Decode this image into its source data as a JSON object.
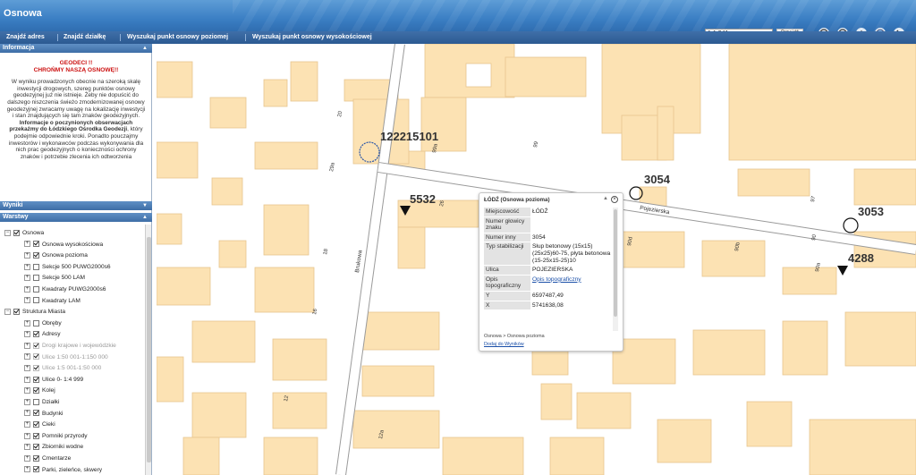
{
  "app": {
    "title": "Osnowa"
  },
  "toolbar": {
    "buttons": [
      "Znajdź adres",
      "Znajdź działkę",
      "Wyszukaj punkt osnowy poziomej",
      "Wyszukaj punkt osnowy wysokościowej"
    ],
    "scale_value": "1:1 241",
    "goto_label": "Przejdź"
  },
  "tools": [
    "zoom-in-icon",
    "zoom-out-icon",
    "pan-hand-icon",
    "zoom-extent-icon",
    "back-arrow-icon"
  ],
  "panels": {
    "info": {
      "title": "Informacja",
      "warning_line1": "GEODECI !!",
      "warning_line2": "CHROŃMY NASZĄ OSNOWĘ!!",
      "body_part1": "W wyniku prowadzonych obecnie na szeroką skalę inwestycji drogowych, szereg punktów osnowy geodezyjnej już nie istnieje. Żeby nie dopuścić do dalszego niszczenia świeżo zmodernizowanej osnowy geodezyjnej zwracamy uwagę na lokalizację inwestycji i stan znajdujących się tam znaków geodezyjnych. ",
      "body_bold1": "Informacje o poczynionych obserwacjach przekażmy do Łódzkiego Ośrodka Geodezji",
      "body_part2": ", który podejmie odpowiednie kroki. Ponadto pouczajmy inwestorów i wykonawców podczas wykonywania dla nich prac geodezyjnych o konieczności ochrony znaków i potrzebie zlecenia ich odtworzenia"
    },
    "results": {
      "title": "Wyniki"
    },
    "layers": {
      "title": "Warstwy",
      "items": [
        {
          "label": "Osnowa",
          "level": 0,
          "checked": true,
          "disabled": false
        },
        {
          "label": "Osnowa wysokościowa",
          "level": 1,
          "checked": true,
          "disabled": false
        },
        {
          "label": "Osnowa pozioma",
          "level": 1,
          "checked": true,
          "disabled": false
        },
        {
          "label": "Sekcje 500 PUWG2000s6",
          "level": 1,
          "checked": false,
          "disabled": false
        },
        {
          "label": "Sekcje 500 LAM",
          "level": 1,
          "checked": false,
          "disabled": false
        },
        {
          "label": "Kwadraty PUWG2000s6",
          "level": 1,
          "checked": false,
          "disabled": false
        },
        {
          "label": "Kwadraty LAM",
          "level": 1,
          "checked": false,
          "disabled": false
        },
        {
          "label": "Struktura Miasta",
          "level": 0,
          "checked": true,
          "disabled": false
        },
        {
          "label": "Obręby",
          "level": 1,
          "checked": false,
          "disabled": false
        },
        {
          "label": "Adresy",
          "level": 1,
          "checked": true,
          "disabled": false
        },
        {
          "label": "Drogi krajowe i wojewódzkie",
          "level": 1,
          "checked": true,
          "disabled": true
        },
        {
          "label": "Ulice 1:50 001-1:150 000",
          "level": 1,
          "checked": true,
          "disabled": true
        },
        {
          "label": "Ulice 1:5 001-1:50 000",
          "level": 1,
          "checked": true,
          "disabled": true
        },
        {
          "label": "Ulice 0- 1:4 999",
          "level": 1,
          "checked": true,
          "disabled": false
        },
        {
          "label": "Kolej",
          "level": 1,
          "checked": true,
          "disabled": false
        },
        {
          "label": "Działki",
          "level": 1,
          "checked": false,
          "disabled": false
        },
        {
          "label": "Budynki",
          "level": 1,
          "checked": true,
          "disabled": false
        },
        {
          "label": "Cieki",
          "level": 1,
          "checked": true,
          "disabled": false
        },
        {
          "label": "Pomniki przyrody",
          "level": 1,
          "checked": true,
          "disabled": false
        },
        {
          "label": "Zbiorniki wodne",
          "level": 1,
          "checked": true,
          "disabled": false
        },
        {
          "label": "Cmentarze",
          "level": 1,
          "checked": true,
          "disabled": false
        },
        {
          "label": "Parki, zieleńce, skwery",
          "level": 1,
          "checked": true,
          "disabled": false
        }
      ]
    }
  },
  "map": {
    "points": [
      "122215101",
      "5532",
      "3054",
      "3053",
      "4288"
    ],
    "streets": [
      "Brukowa",
      "Pojezierska"
    ],
    "numbers": [
      "20",
      "99",
      "99a",
      "29a",
      "26",
      "18",
      "16",
      "12",
      "12a",
      "97",
      "90",
      "90d",
      "90b",
      "90a"
    ]
  },
  "popup": {
    "title": "ŁÓDŹ (Osnowa pozioma)",
    "rows": [
      {
        "key": "Miejscowość",
        "value": "ŁÓDŹ"
      },
      {
        "key": "Numer głowicy znaku",
        "value": ""
      },
      {
        "key": "Numer inny",
        "value": "3054"
      },
      {
        "key": "Typ stabilizacji",
        "value": "Słup betonowy (15x15) (25x25)60-75, płyta betonowa (15-25x15-25)10"
      },
      {
        "key": "Ulica",
        "value": "POJEZIERSKA"
      },
      {
        "key": "Opis topograficzny",
        "value": "Opis topograficzny"
      },
      {
        "key": "Y",
        "value": "6597487,49"
      },
      {
        "key": "X",
        "value": "5741638,08"
      }
    ],
    "path": "Osnowa > Osnowa pozioma",
    "add_link": "Dodaj do Wyników"
  },
  "colors": {
    "building": "#fce2b3",
    "building_stroke": "#e7c58f",
    "street": "#8f8f8f",
    "header": "#3b7fc4"
  }
}
